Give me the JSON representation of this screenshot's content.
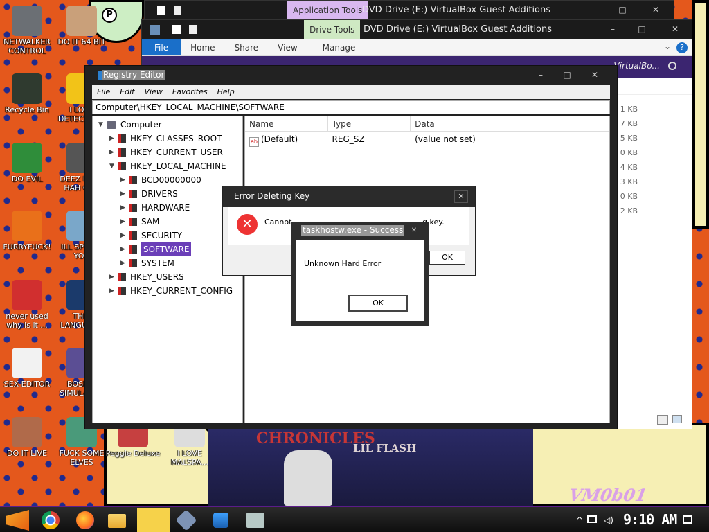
{
  "desktop_icons": [
    {
      "label": "NETWALKER CONTROL",
      "color": "#6b6f74"
    },
    {
      "label": "DO IT 64 BIT",
      "color": "#c9a07a"
    },
    {
      "label": "Recycle Bin",
      "color": "#2f3a2f"
    },
    {
      "label": "I LOVE DETECTIVES",
      "color": "#f2c318"
    },
    {
      "label": "DO EVIL",
      "color": "#2f8d3a"
    },
    {
      "label": "DEEZ NUTS HAH GOT",
      "color": "#555555"
    },
    {
      "label": "FURRYFUCK!",
      "color": "#e9701a"
    },
    {
      "label": "ILL SPY ON YOU",
      "color": "#7aa7c9"
    },
    {
      "label": "never used why is it ...",
      "color": "#d12f2f"
    },
    {
      "label": "THIS LANGUAGE",
      "color": "#1b3a6b"
    },
    {
      "label": "SEX EDITOR",
      "color": "#f2f2f2"
    },
    {
      "label": "BOSNIA SIMULATOR",
      "color": "#5b4e94"
    },
    {
      "label": "DO IT LIVE",
      "color": "#b06a4a"
    },
    {
      "label": "FUCK SOME ELVES",
      "color": "#4a9a7a"
    },
    {
      "label": "Peggle Deluxe",
      "color": "#c64040"
    },
    {
      "label": "I LOVE MALSPA...",
      "color": "#dddddd"
    }
  ],
  "wallpaper": {
    "title": "CHRONICLES",
    "subtitle": "LIL FLASH",
    "watermark": "VM0b01",
    "sticker_letter": "P"
  },
  "explorer_back": {
    "context_tab": "Application Tools",
    "title": "DVD Drive (E:) VirtualBox Guest Additions"
  },
  "explorer_front": {
    "context_tab": "Drive Tools",
    "title": "DVD Drive (E:) VirtualBox Guest Additions",
    "tabs": [
      "File",
      "Home",
      "Share",
      "View",
      "Manage"
    ],
    "address": "VirtualBo...",
    "sizes": [
      "1 KB",
      "7 KB",
      "5 KB",
      "0 KB",
      "4 KB",
      "3 KB",
      "0 KB",
      "2 KB"
    ],
    "controls": {
      "minimize": "–",
      "maximize": "□",
      "close": "✕"
    },
    "help": "?",
    "collapse": "⌄"
  },
  "regedit": {
    "title": "Registry Editor",
    "menu": [
      "File",
      "Edit",
      "View",
      "Favorites",
      "Help"
    ],
    "address": "Computer\\HKEY_LOCAL_MACHINE\\SOFTWARE",
    "tree": [
      {
        "label": "Computer",
        "level": 0,
        "expanded": true,
        "root": true
      },
      {
        "label": "HKEY_CLASSES_ROOT",
        "level": 1
      },
      {
        "label": "HKEY_CURRENT_USER",
        "level": 1
      },
      {
        "label": "HKEY_LOCAL_MACHINE",
        "level": 1,
        "expanded": true
      },
      {
        "label": "BCD00000000",
        "level": 2
      },
      {
        "label": "DRIVERS",
        "level": 2
      },
      {
        "label": "HARDWARE",
        "level": 2
      },
      {
        "label": "SAM",
        "level": 2
      },
      {
        "label": "SECURITY",
        "level": 2
      },
      {
        "label": "SOFTWARE",
        "level": 2,
        "selected": true
      },
      {
        "label": "SYSTEM",
        "level": 2
      },
      {
        "label": "HKEY_USERS",
        "level": 1
      },
      {
        "label": "HKEY_CURRENT_CONFIG",
        "level": 1
      }
    ],
    "columns": [
      "Name",
      "Type",
      "Data"
    ],
    "rows": [
      {
        "name": "(Default)",
        "type": "REG_SZ",
        "data": "(value not set)",
        "icon": "ab"
      }
    ],
    "controls": {
      "minimize": "–",
      "maximize": "□",
      "close": "✕"
    }
  },
  "error_dialog": {
    "title": "Error Deleting Key",
    "message_start": "Cannot",
    "message_end": "g key.",
    "ok": "OK",
    "close": "✕",
    "icon": "✕"
  },
  "success_dialog": {
    "title": "taskhostw.exe - Success",
    "message": "Unknown Hard Error",
    "ok": "OK",
    "close": "✕"
  },
  "taskbar": {
    "clock": "9:10 AM",
    "items": [
      "start",
      "chrome",
      "firefox",
      "file-explorer",
      "notes",
      "virtualbox",
      "regedit",
      "control-panel"
    ],
    "active_item": "notes"
  }
}
